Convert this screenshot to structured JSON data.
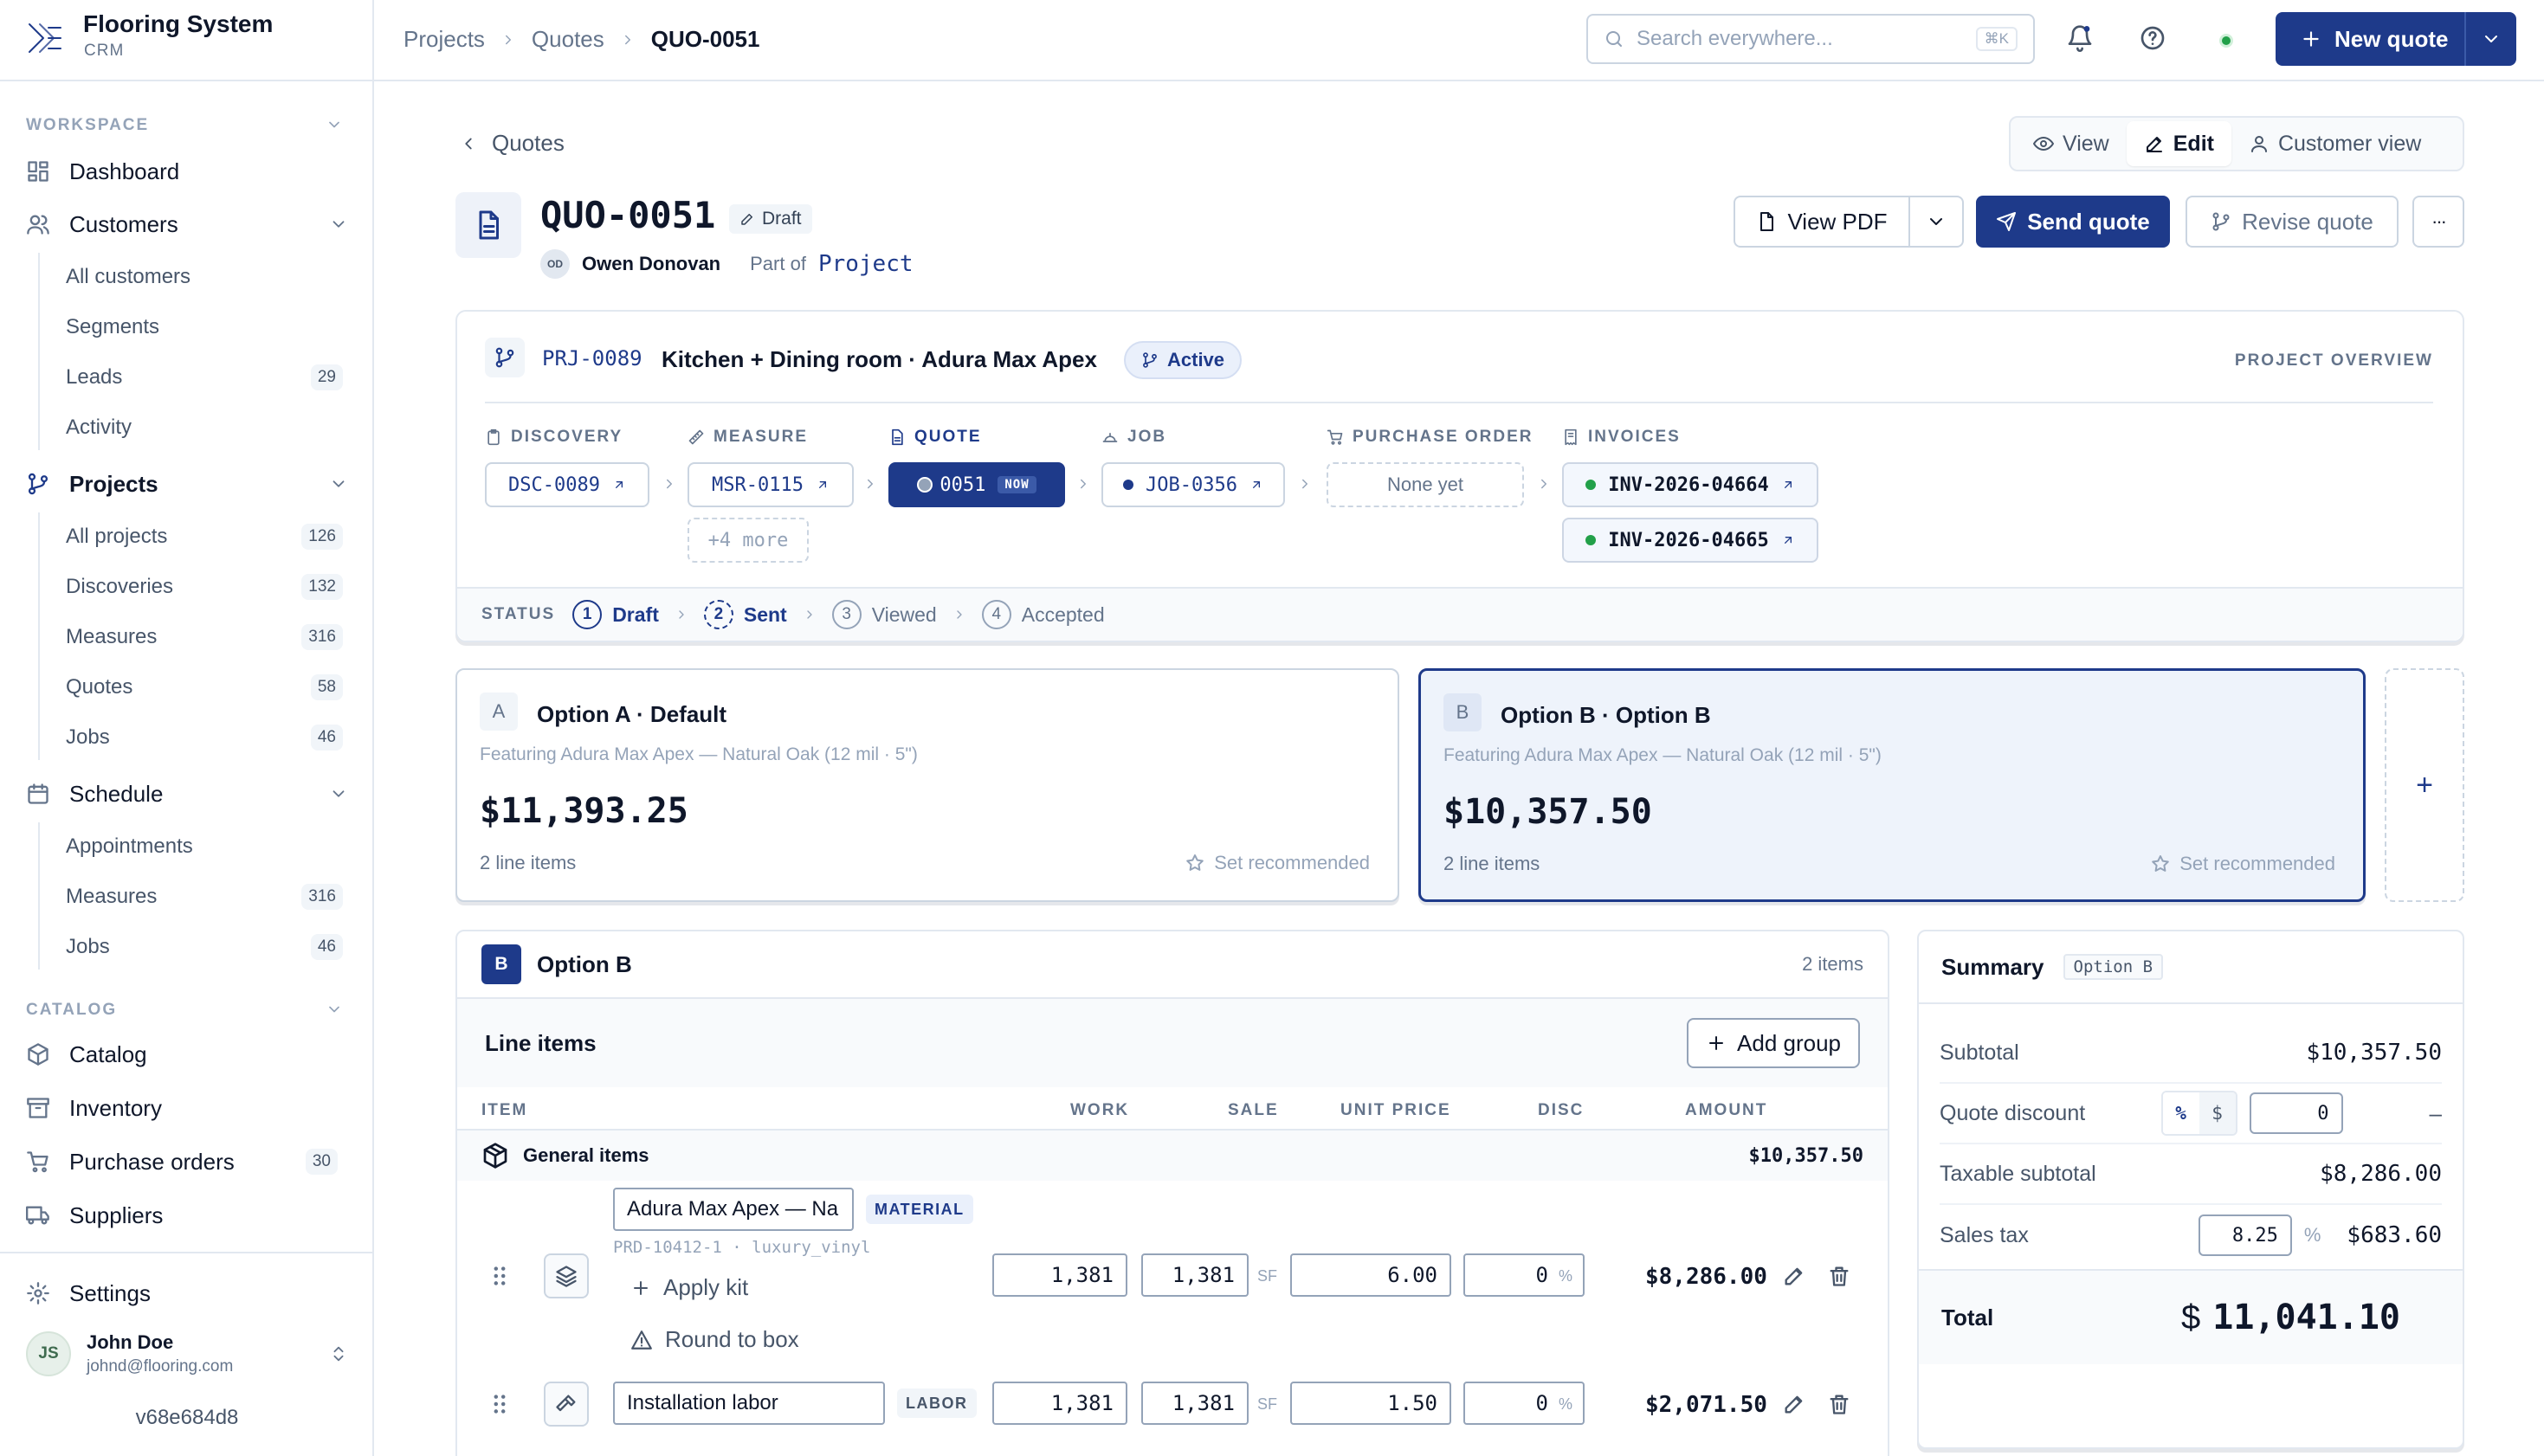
{
  "brand": {
    "name": "Flooring System",
    "sub": "CRM"
  },
  "sidebar": {
    "workspace_label": "WORKSPACE",
    "catalog_label": "CATALOG",
    "dashboard": "Dashboard",
    "customers": {
      "label": "Customers",
      "items": [
        {
          "label": "All customers",
          "count": ""
        },
        {
          "label": "Segments",
          "count": ""
        },
        {
          "label": "Leads",
          "count": "29"
        },
        {
          "label": "Activity",
          "count": ""
        }
      ]
    },
    "projects": {
      "label": "Projects",
      "items": [
        {
          "label": "All projects",
          "count": "126"
        },
        {
          "label": "Discoveries",
          "count": "132"
        },
        {
          "label": "Measures",
          "count": "316"
        },
        {
          "label": "Quotes",
          "count": "58"
        },
        {
          "label": "Jobs",
          "count": "46"
        }
      ]
    },
    "schedule": {
      "label": "Schedule",
      "items": [
        {
          "label": "Appointments",
          "count": ""
        },
        {
          "label": "Measures",
          "count": "316"
        },
        {
          "label": "Jobs",
          "count": "46"
        }
      ]
    },
    "catalog": "Catalog",
    "inventory": "Inventory",
    "purchase_orders": {
      "label": "Purchase orders",
      "count": "30"
    },
    "suppliers": "Suppliers",
    "settings": "Settings",
    "user": {
      "initials": "JS",
      "name": "John Doe",
      "email": "johnd@flooring.com"
    },
    "version": "v68e684d8"
  },
  "topbar": {
    "breadcrumb": [
      "Projects",
      "Quotes",
      "QUO-0051"
    ],
    "search_placeholder": "Search everywhere...",
    "search_kbd": "⌘K",
    "new_quote": "New quote"
  },
  "quote": {
    "back": "Quotes",
    "view_modes": [
      "View",
      "Edit",
      "Customer view"
    ],
    "active_mode": "Edit",
    "number": "QUO-0051",
    "status_badge": "Draft",
    "owner_initials": "OD",
    "owner": "Owen Donovan",
    "part_of": "Part of",
    "project_link": "Project",
    "actions": {
      "view_pdf": "View PDF",
      "send": "Send quote",
      "revise": "Revise quote",
      "more": "···"
    }
  },
  "project": {
    "code": "PRJ-0089",
    "name": "Kitchen + Dining room · Adura Max Apex",
    "status": "Active",
    "overview_label": "PROJECT OVERVIEW",
    "stages": {
      "discovery": {
        "label": "DISCOVERY",
        "chip": "DSC-0089"
      },
      "measure": {
        "label": "MEASURE",
        "chip": "MSR-0115",
        "more": "+4 more"
      },
      "quote": {
        "label": "QUOTE",
        "chip": "0051",
        "now": "NOW"
      },
      "job": {
        "label": "JOB",
        "chip": "JOB-0356"
      },
      "purchase_order": {
        "label": "PURCHASE ORDER",
        "chip": "None yet"
      },
      "invoices": {
        "label": "INVOICES",
        "chips": [
          "INV-2026-04664",
          "INV-2026-04665"
        ]
      }
    },
    "status_label": "STATUS",
    "steps": [
      {
        "n": "1",
        "label": "Draft"
      },
      {
        "n": "2",
        "label": "Sent"
      },
      {
        "n": "3",
        "label": "Viewed"
      },
      {
        "n": "4",
        "label": "Accepted"
      }
    ]
  },
  "options": [
    {
      "letter": "A",
      "title": "Option A · Default",
      "featuring": "Featuring Adura Max Apex — Natural Oak (12 mil · 5\")",
      "price": "$11,393.25",
      "items": "2 line items",
      "recommend": "Set recommended"
    },
    {
      "letter": "B",
      "title": "Option B · Option B",
      "featuring": "Featuring Adura Max Apex — Natural Oak (12 mil · 5\")",
      "price": "$10,357.50",
      "items": "2 line items",
      "recommend": "Set recommended"
    }
  ],
  "option_add": "+",
  "line_card": {
    "letter": "B",
    "title": "Option B",
    "count": "2 items",
    "section": "Line items",
    "add_group": "Add group",
    "cols": {
      "item": "ITEM",
      "work": "WORK",
      "sale": "SALE",
      "unit_price": "UNIT PRICE",
      "disc": "DISC",
      "amount": "AMOUNT"
    },
    "group": {
      "name": "General items",
      "amount": "$10,357.50"
    },
    "rows": [
      {
        "name": "Adura Max Apex — Na",
        "type": "MATERIAL",
        "sku": "PRD-10412-1 · luxury_vinyl",
        "work": "1,381",
        "sale": "1,381",
        "unit": "SF",
        "price": "6.00",
        "disc": "0",
        "disc_unit": "%",
        "amount": "$8,286.00",
        "apply_kit": "Apply kit",
        "round": "Round to box"
      },
      {
        "name": "Installation labor",
        "type": "LABOR",
        "work": "1,381",
        "sale": "1,381",
        "unit": "SF",
        "price": "1.50",
        "disc": "0",
        "disc_unit": "%",
        "amount": "$2,071.50"
      }
    ]
  },
  "summary": {
    "title": "Summary",
    "tag": "Option B",
    "subtotal_label": "Subtotal",
    "subtotal": "$10,357.50",
    "discount_label": "Quote discount",
    "discount_value": "0",
    "discount_amount": "–",
    "seg": [
      "%",
      "$"
    ],
    "taxable_label": "Taxable subtotal",
    "taxable": "$8,286.00",
    "tax_label": "Sales tax",
    "tax_rate": "8.25",
    "tax_unit": "%",
    "tax": "$683.60",
    "total_label": "Total",
    "currency": "$",
    "total": "11,041.10"
  },
  "colors": {
    "primary": "#1e3a8a",
    "online": "#22a049"
  }
}
